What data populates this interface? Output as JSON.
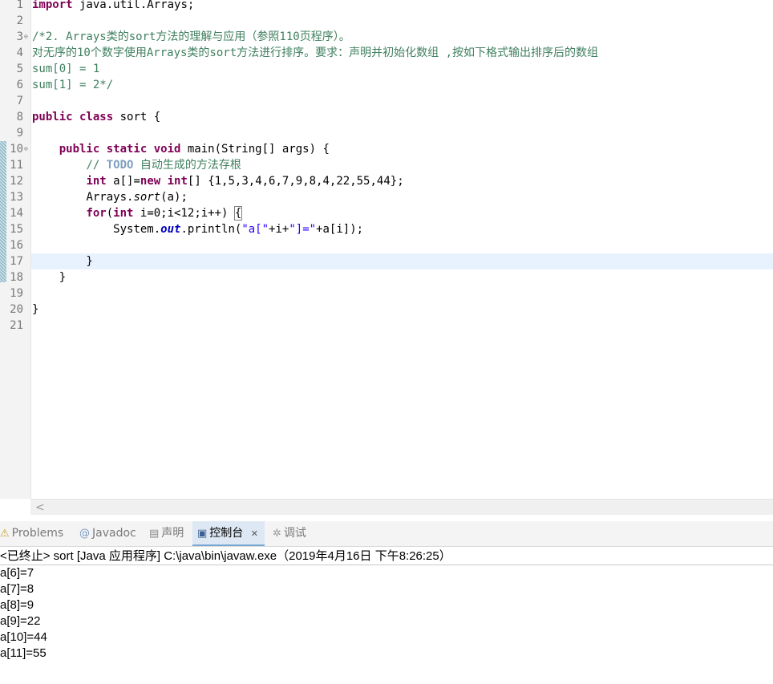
{
  "editor": {
    "line_numbers": [
      "1",
      "2",
      "3",
      "4",
      "5",
      "6",
      "7",
      "8",
      "9",
      "10",
      "11",
      "12",
      "13",
      "14",
      "15",
      "16",
      "17",
      "18",
      "19",
      "20",
      "21"
    ],
    "fold_marker": "⊖",
    "code": {
      "l1_kw": "import",
      "l1_rest": " java.util.Arrays;",
      "l3": "/*2. Arrays类的sort方法的理解与应用（参照110页程序）。",
      "l4": "对无序的10个数字使用Arrays类的sort方法进行排序。要求：声明并初始化数组 ,按如下格式输出排序后的数组",
      "l5": "sum[0] = 1",
      "l6": "sum[1] = 2*/",
      "l8_kw": "public class",
      "l8_rest": " sort {",
      "l10_indent": "    ",
      "l10_kw": "public static void",
      "l10_rest": " main(String[] args) {",
      "l11_indent": "        ",
      "l11_slashes": "// ",
      "l11_todo": "TODO",
      "l11_text": " 自动生成的方法存根",
      "l12_indent": "        ",
      "l12_kw1": "int",
      "l12_mid": " a[]=",
      "l12_kw2": "new int",
      "l12_rest": "[] {1,5,3,4,6,7,9,8,4,22,55,44};",
      "l13_indent": "        ",
      "l13_pre": "Arrays.",
      "l13_method": "sort",
      "l13_post": "(a);",
      "l14_indent": "        ",
      "l14_kw1": "for",
      "l14_paren": "(",
      "l14_kw2": "int",
      "l14_rest": " i=0;i<12;i++) ",
      "l14_brace": "{",
      "l15_indent": "            ",
      "l15_pre": "System.",
      "l15_field": "out",
      "l15_mid": ".println(",
      "l15_str1": "\"a[\"",
      "l15_mid2": "+i+",
      "l15_str2": "\"]=\"",
      "l15_post": "+a[i]);",
      "l17": "        }",
      "l18": "    }",
      "l20": "}"
    },
    "scroll_left_arrow": "<"
  },
  "panel": {
    "tabs": [
      {
        "icon": "⚠",
        "label": "Problems"
      },
      {
        "icon": "@",
        "label": "Javadoc"
      },
      {
        "icon": "▤",
        "label": "声明"
      },
      {
        "icon": "▣",
        "label": "控制台"
      },
      {
        "icon": "✲",
        "label": "调试"
      }
    ],
    "close_glyph": "✕"
  },
  "console": {
    "status": "<已终止> sort [Java 应用程序] C:\\java\\bin\\javaw.exe（2019年4月16日 下午8:26:25）",
    "output": [
      "a[6]=7",
      "a[7]=8",
      "a[8]=9",
      "a[9]=22",
      "a[10]=44",
      "a[11]=55"
    ]
  }
}
